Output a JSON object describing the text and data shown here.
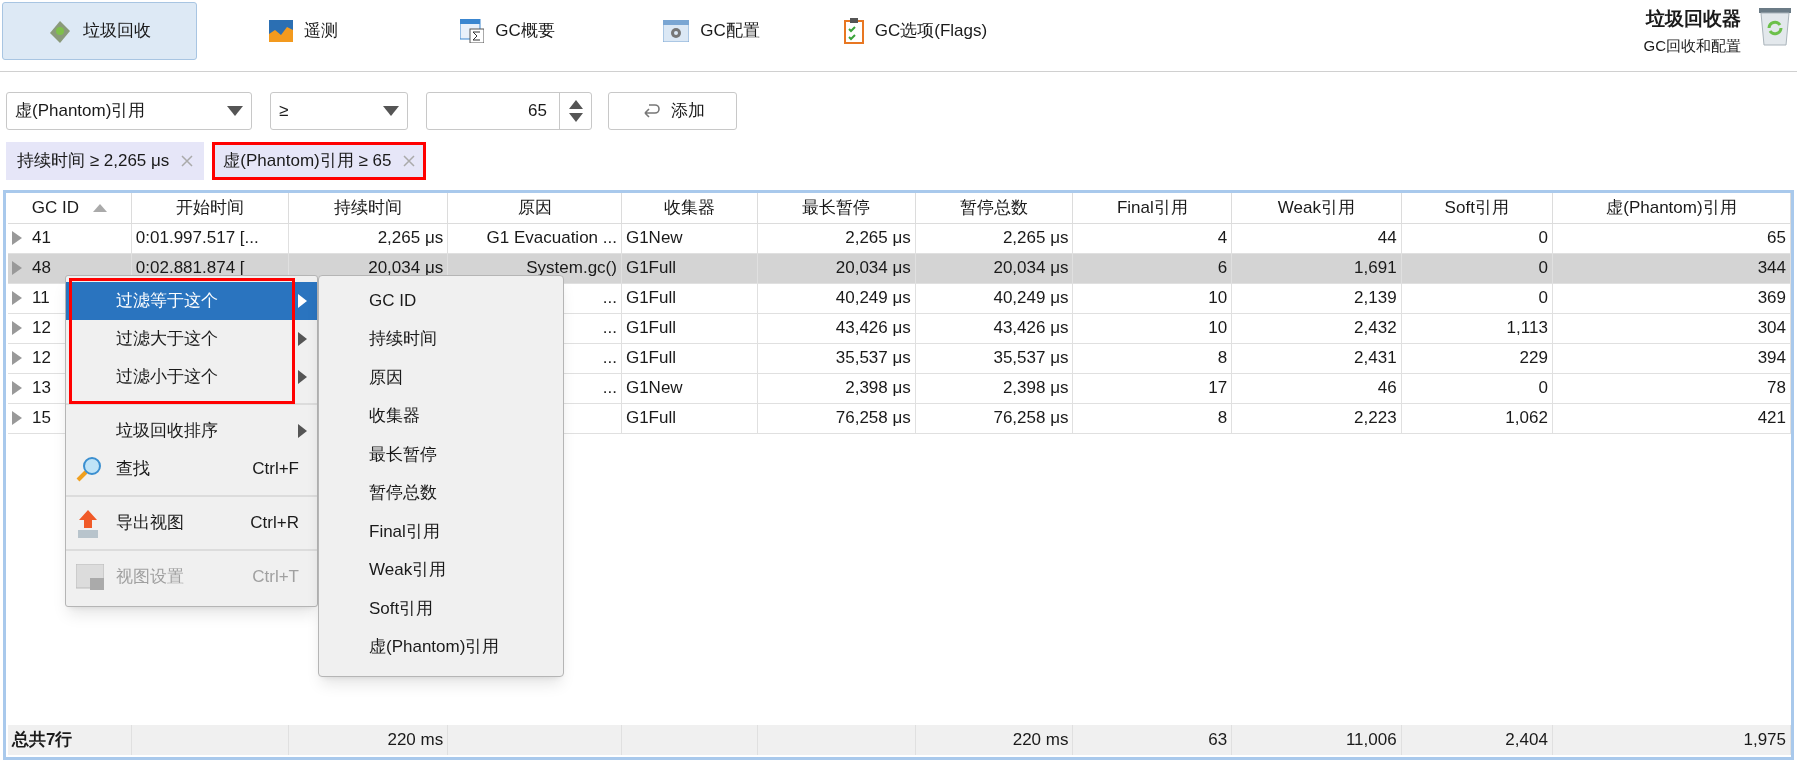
{
  "toolbar": {
    "tabs": [
      {
        "label": "垃圾回收",
        "selected": true
      },
      {
        "label": "遥测",
        "selected": false
      },
      {
        "label": "GC概要",
        "selected": false
      },
      {
        "label": "GC配置",
        "selected": false
      },
      {
        "label": "GC选项(Flags)",
        "selected": false
      }
    ]
  },
  "header": {
    "title": "垃圾回收器",
    "subtitle": "GC回收和配置"
  },
  "filter": {
    "field": "虚(Phantom)引用",
    "operator": "≥",
    "value": "65",
    "add_button": "添加"
  },
  "chips": [
    {
      "label": "持续时间 ≥ 2,265 μs",
      "outlined": false
    },
    {
      "label": "虚(Phantom)引用 ≥ 65",
      "outlined": true
    }
  ],
  "table": {
    "columns": [
      {
        "label": "GC ID",
        "sorted": true
      },
      {
        "label": "开始时间",
        "sorted": false
      },
      {
        "label": "持续时间",
        "sorted": false
      },
      {
        "label": "原因",
        "sorted": false
      },
      {
        "label": "收集器",
        "sorted": false
      },
      {
        "label": "最长暂停",
        "sorted": false
      },
      {
        "label": "暂停总数",
        "sorted": false
      },
      {
        "label": "Final引用",
        "sorted": false
      },
      {
        "label": "Weak引用",
        "sorted": false
      },
      {
        "label": "Soft引用",
        "sorted": false
      },
      {
        "label": "虚(Phantom)引用",
        "sorted": false
      }
    ],
    "rows": [
      {
        "selected": false,
        "gc_id": "41",
        "start_time": "0:01.997.517 [...",
        "duration": "2,265 μs",
        "cause": "G1 Evacuation ...",
        "collector": "G1New",
        "max_pause": "2,265 μs",
        "total_pause": "2,265 μs",
        "final_refs": "4",
        "weak_refs": "44",
        "soft_refs": "0",
        "phantom_refs": "65"
      },
      {
        "selected": true,
        "gc_id": "48",
        "start_time": "0:02.881.874 [",
        "duration": "20,034 μs",
        "cause": "System.gc()",
        "collector": "G1Full",
        "max_pause": "20,034 μs",
        "total_pause": "20,034 μs",
        "final_refs": "6",
        "weak_refs": "1,691",
        "soft_refs": "0",
        "phantom_refs": "344"
      },
      {
        "selected": false,
        "gc_id": "11",
        "cause": "...",
        "collector": "G1Full",
        "max_pause": "40,249 μs",
        "total_pause": "40,249 μs",
        "final_refs": "10",
        "weak_refs": "2,139",
        "soft_refs": "0",
        "phantom_refs": "369"
      },
      {
        "selected": false,
        "gc_id": "12",
        "cause": "...",
        "collector": "G1Full",
        "max_pause": "43,426 μs",
        "total_pause": "43,426 μs",
        "final_refs": "10",
        "weak_refs": "2,432",
        "soft_refs": "1,113",
        "phantom_refs": "304"
      },
      {
        "selected": false,
        "gc_id": "12",
        "cause": "...",
        "collector": "G1Full",
        "max_pause": "35,537 μs",
        "total_pause": "35,537 μs",
        "final_refs": "8",
        "weak_refs": "2,431",
        "soft_refs": "229",
        "phantom_refs": "394"
      },
      {
        "selected": false,
        "gc_id": "13",
        "cause": "...",
        "collector": "G1New",
        "max_pause": "2,398 μs",
        "total_pause": "2,398 μs",
        "final_refs": "17",
        "weak_refs": "46",
        "soft_refs": "0",
        "phantom_refs": "78"
      },
      {
        "selected": false,
        "gc_id": "15",
        "collector": "G1Full",
        "max_pause": "76,258 μs",
        "total_pause": "76,258 μs",
        "final_refs": "8",
        "weak_refs": "2,223",
        "soft_refs": "1,062",
        "phantom_refs": "421"
      }
    ],
    "footer": {
      "gc_id": "总共7行",
      "duration": "220 ms",
      "total_pause": "220 ms",
      "final_refs": "63",
      "weak_refs": "11,006",
      "soft_refs": "2,404",
      "phantom_refs": "1,975"
    }
  },
  "context_menu": {
    "items": [
      {
        "label": "过滤等于这个",
        "kind": "submenu",
        "selected": true,
        "disabled": false,
        "outlined": true
      },
      {
        "label": "过滤大于这个",
        "kind": "submenu",
        "selected": false,
        "disabled": false,
        "outlined": true
      },
      {
        "label": "过滤小于这个",
        "kind": "submenu",
        "selected": false,
        "disabled": false,
        "outlined": true
      },
      {
        "kind": "separator"
      },
      {
        "label": "垃圾回收排序",
        "kind": "submenu",
        "selected": false,
        "disabled": false,
        "outlined": false
      },
      {
        "label": "查找",
        "kind": "command",
        "shortcut": "Ctrl+F",
        "selected": false,
        "disabled": false,
        "outlined": false
      },
      {
        "kind": "separator"
      },
      {
        "label": "导出视图",
        "kind": "command",
        "shortcut": "Ctrl+R",
        "selected": false,
        "disabled": false,
        "outlined": false
      },
      {
        "kind": "separator"
      },
      {
        "label": "视图设置",
        "kind": "command",
        "shortcut": "Ctrl+T",
        "selected": false,
        "disabled": true,
        "outlined": false
      }
    ],
    "submenu": [
      "GC ID",
      "持续时间",
      "原因",
      "收集器",
      "最长暂停",
      "暂停总数",
      "Final引用",
      "Weak引用",
      "Soft引用",
      "虚(Phantom)引用"
    ]
  }
}
